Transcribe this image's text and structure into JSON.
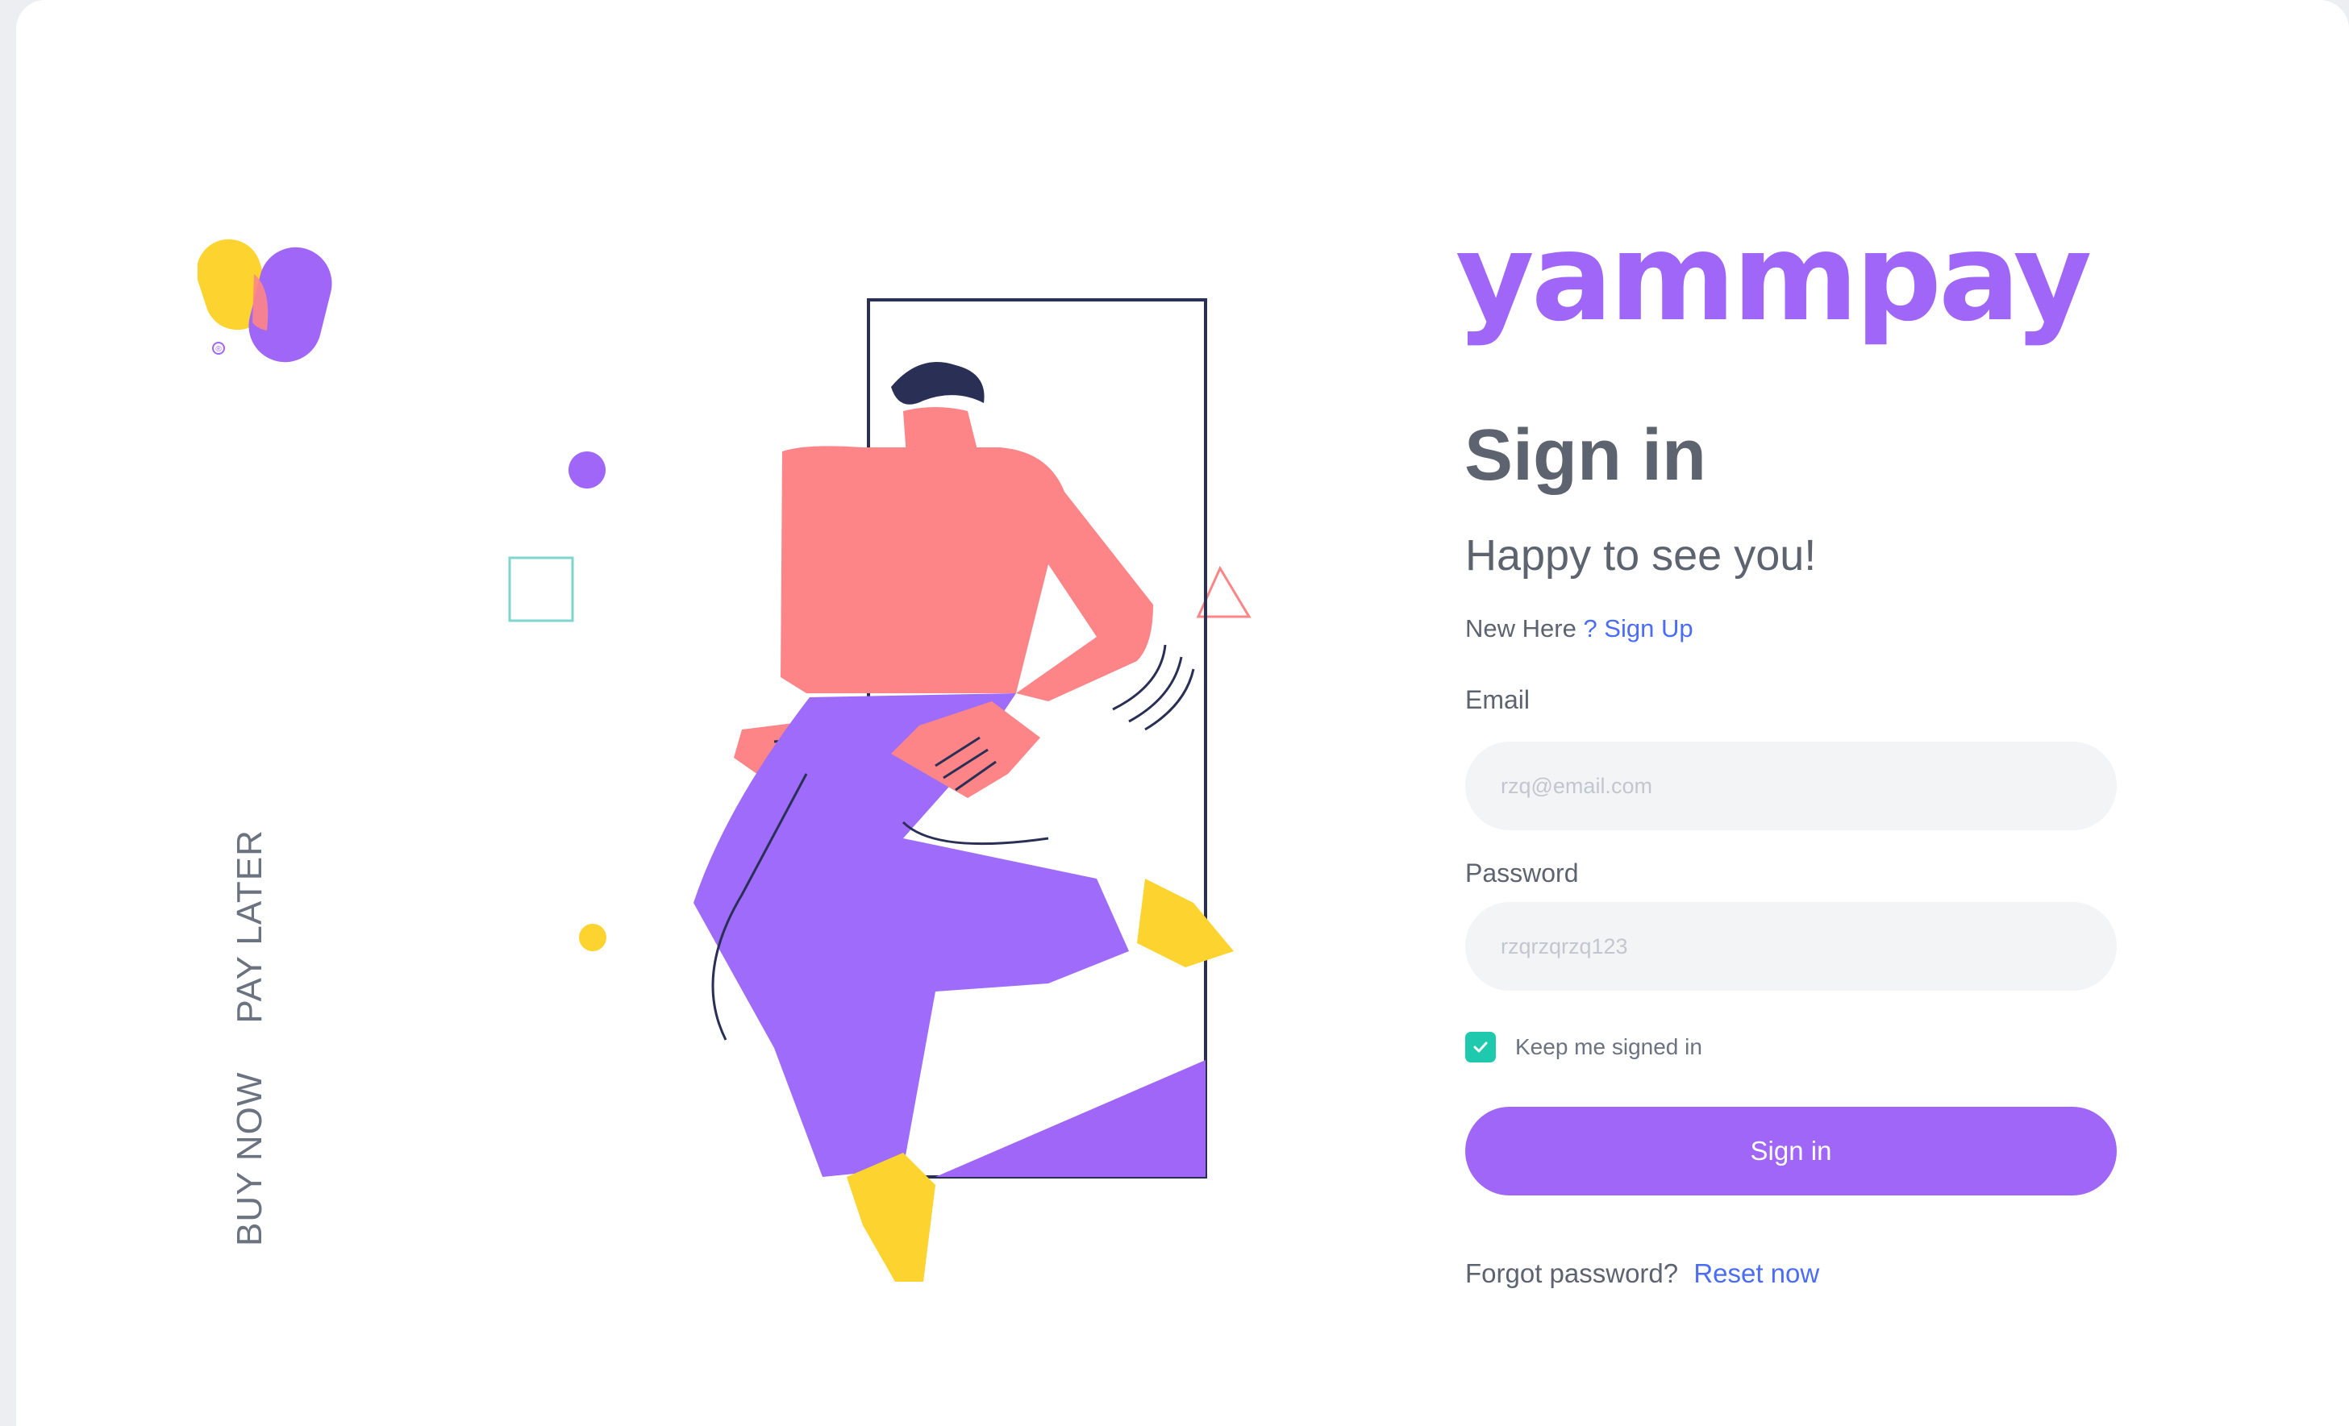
{
  "brand": {
    "name": "yammpay",
    "tagline_buy": "BUY NOW",
    "tagline_pay": "PAY LATER",
    "registered_mark": "®"
  },
  "form": {
    "title": "Sign in",
    "subtitle": "Happy to see you!",
    "new_here_text": "New Here",
    "signup_link": "? Sign Up",
    "email_label": "Email",
    "email_placeholder": "rzq@email.com",
    "password_label": "Password",
    "password_placeholder": "rzqrzqrzq123",
    "keep_signed_in_label": "Keep me signed in",
    "keep_signed_in_checked": true,
    "submit_label": "Sign in",
    "forgot_text": "Forgot password?",
    "reset_link": "Reset now"
  },
  "colors": {
    "accent": "#a066f7",
    "link": "#4a6cf7",
    "checkbox": "#1fc9ad",
    "logo_yellow": "#fdd330",
    "illustration_pink": "#fd8587"
  },
  "icons": [
    "brand-logo-icon",
    "check-icon"
  ]
}
